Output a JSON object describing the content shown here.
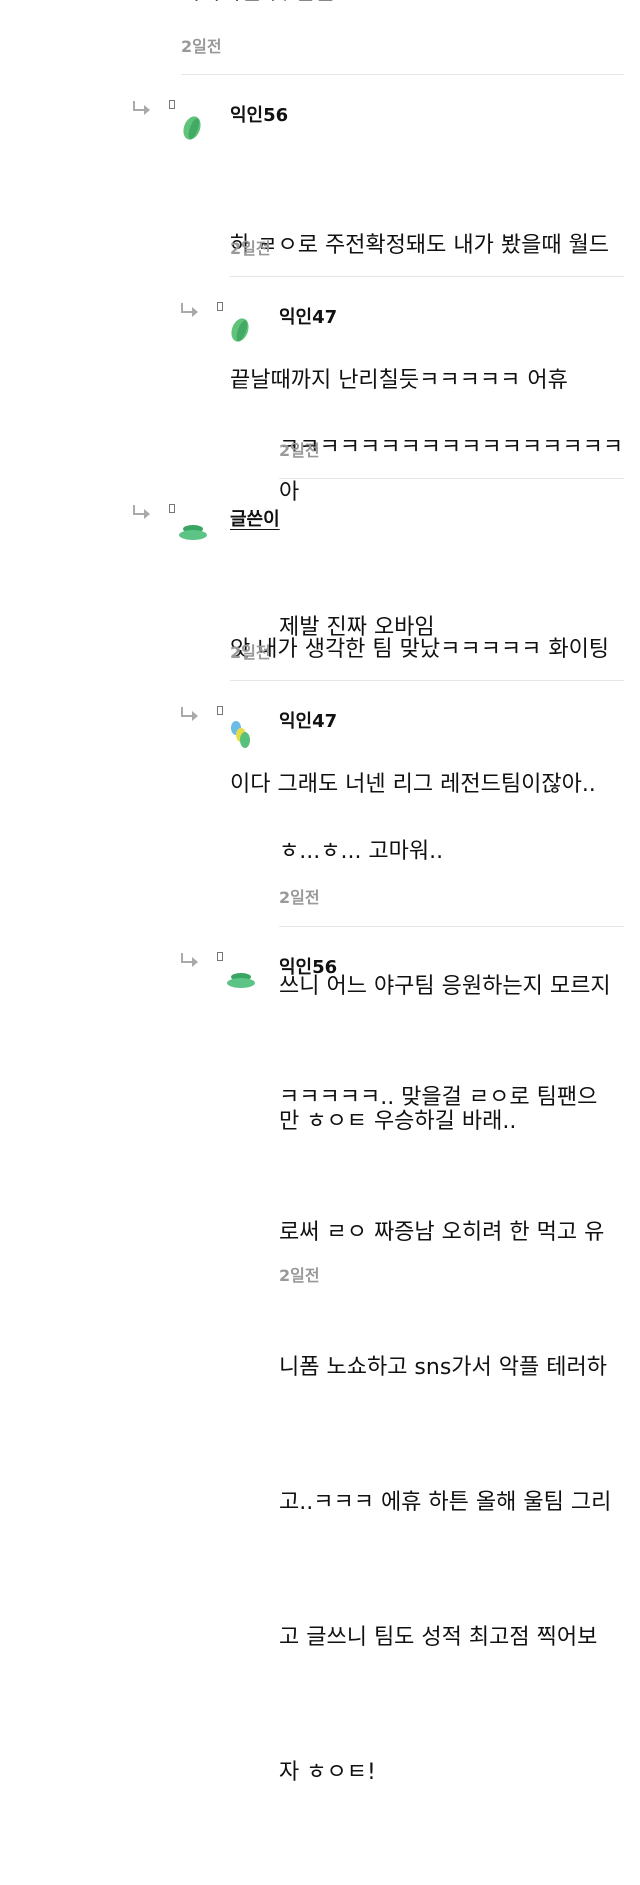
{
  "top_comment": {
    "partial_text": "미치미일 것 같음",
    "time": "2일전"
  },
  "comments": [
    {
      "author": "익인56",
      "lines": [
        "하 ㄹㅇ로 주전확정돼도 내가 봤을때 월드",
        "끝날때까지 난리칠듯ㅋㅋㅋㅋㅋ 어휴"
      ],
      "time": "2일전",
      "avatar_colors": [
        "#5fc37a",
        "#2f9a55"
      ]
    },
    {
      "author": "익인47",
      "lines": [
        "ㅋㅋㅋㅋㅋㅋㅋㅋㅋㅋㅋㅋㅋㅋㅋㅋㅋ 아",
        "제발 진짜 오바임"
      ],
      "time": "2일전",
      "avatar_colors": [
        "#5fc37a",
        "#2f9a55"
      ]
    },
    {
      "author": "글쓴이",
      "lines": [
        "앗 내가 생각한 팀 맞났ㅋㅋㅋㅋㅋ 화이팅",
        "이다 그래도 너넨 리그 레전드팀이잖아.."
      ],
      "time": "2일전",
      "avatar_colors": [
        "#5cc585",
        "#3aa564"
      ]
    },
    {
      "author": "익인47",
      "lines": [
        "ㅎ...ㅎ... 고마워..",
        "쓰니 어느 야구팀 응원하는지 모르지",
        "만 ㅎㅇㅌ 우승하길 바래.."
      ],
      "time": "2일전",
      "avatar_colors": [
        "#6bbbe6",
        "#e4dd4a",
        "#57c07a"
      ]
    },
    {
      "author": "익인56",
      "lines": [
        "ㅋㅋㅋㅋㅋ.. 맞을걸 ㄹㅇ로 팀팬으",
        "로써 ㄹㅇ 짜증남 오히려 한 먹고 유",
        "니폼 노쇼하고 sns가서 악플 테러하",
        "고..ㅋㅋㅋ 에휴 하튼 올해 울팀 그리",
        "고 글쓰니 팀도 성적 최고점 찍어보",
        "자 ㅎㅇㅌ!"
      ],
      "time": "2일전",
      "avatar_colors": [
        "#5cc585",
        "#3aa564"
      ]
    }
  ]
}
